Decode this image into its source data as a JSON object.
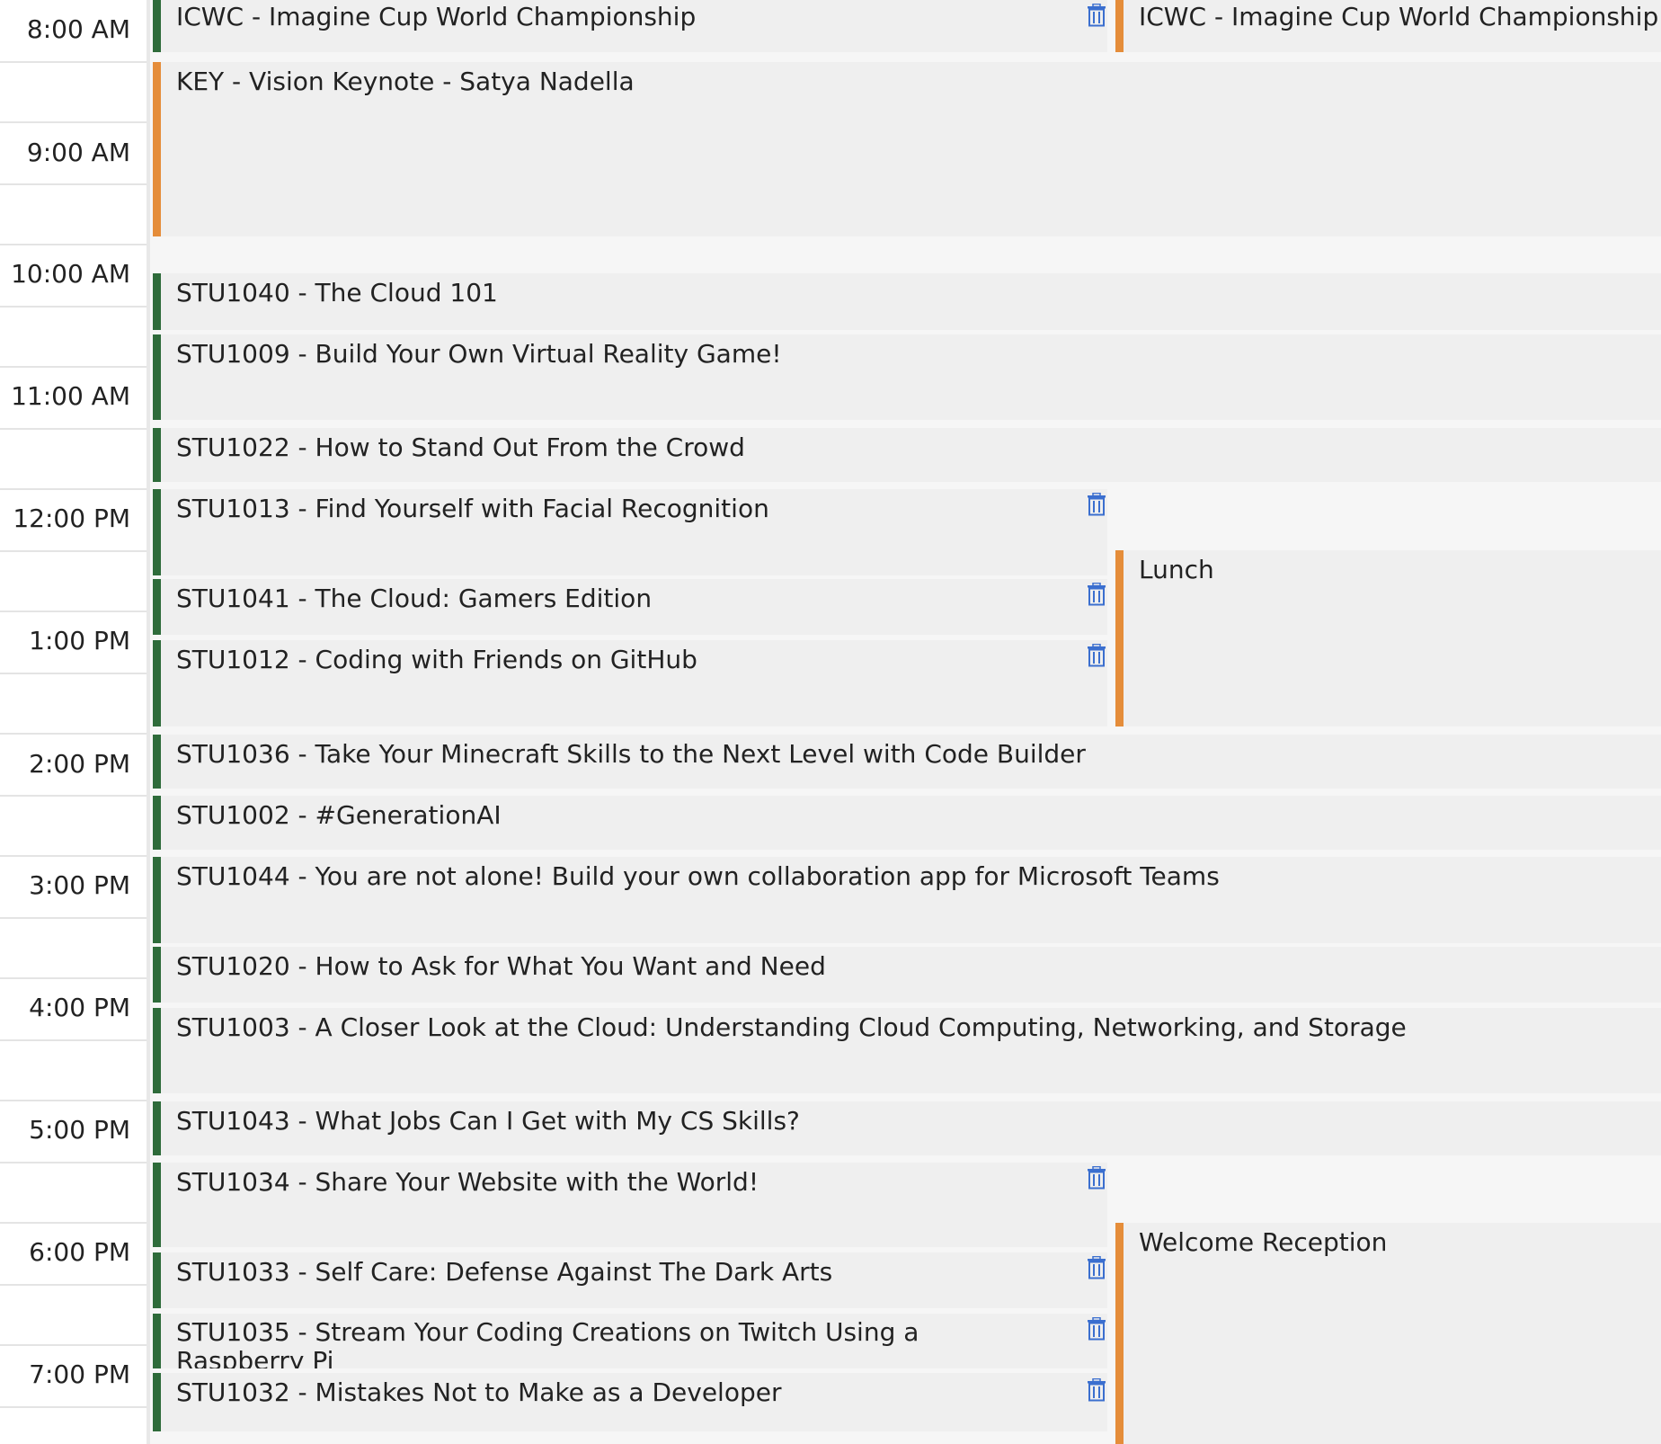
{
  "times": [
    "8:00 AM",
    "9:00 AM",
    "10:00 AM",
    "11:00 AM",
    "12:00 PM",
    "1:00 PM",
    "2:00 PM",
    "3:00 PM",
    "4:00 PM",
    "5:00 PM",
    "6:00 PM",
    "7:00 PM"
  ],
  "events": [
    {
      "title": "ICWC - Imagine Cup World Championship"
    },
    {
      "title": "KEY - Vision Keynote - Satya Nadella"
    },
    {
      "title": "STU1040 - The Cloud 101"
    },
    {
      "title": "STU1009 - Build Your Own Virtual Reality Game!"
    },
    {
      "title": "STU1022 - How to Stand Out From the Crowd"
    },
    {
      "title": "STU1013 - Find Yourself with Facial Recognition"
    },
    {
      "title": "STU1041 - The Cloud: Gamers Edition"
    },
    {
      "title": "STU1012 - Coding with Friends on GitHub"
    },
    {
      "title": "STU1036 - Take Your Minecraft Skills to the Next Level with Code Builder"
    },
    {
      "title": "STU1002 - #GenerationAI"
    },
    {
      "title": "STU1044 - You are not alone! Build your own collaboration app for Microsoft Teams"
    },
    {
      "title": "STU1020 - How to Ask for What You Want and Need"
    },
    {
      "title": "STU1003 - A Closer Look at the Cloud: Understanding Cloud Computing, Networking, and Storage"
    },
    {
      "title": "STU1043 - What Jobs Can I Get with My CS Skills?"
    },
    {
      "title": "STU1034 - Share Your Website with the World!"
    },
    {
      "title": "STU1033 - Self Care: Defense Against The Dark Arts"
    },
    {
      "title": "STU1035 - Stream Your Coding Creations on Twitch Using a Raspberry Pi"
    },
    {
      "title": "STU1032 - Mistakes Not to Make as a Developer"
    },
    {
      "title": "ICWC - Imagine Cup World Championship"
    },
    {
      "title": "Lunch"
    },
    {
      "title": "Welcome Reception"
    }
  ],
  "colors": {
    "student_track": "#2e6b3a",
    "general_track": "#e58d3a",
    "event_bg": "#efefef",
    "delete_icon": "#3b6fcf"
  },
  "icons": {
    "delete": "trash-icon"
  }
}
